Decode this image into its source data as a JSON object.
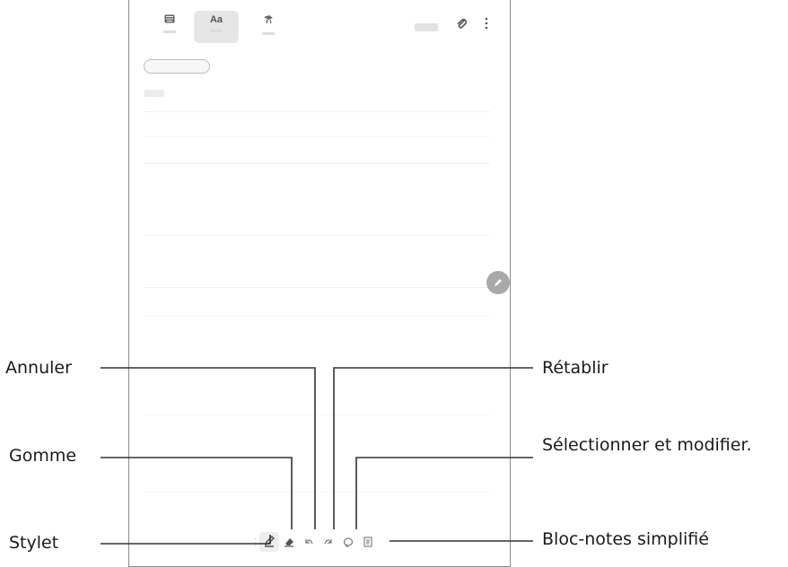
{
  "toolbar": {
    "modes": [
      {
        "icon": "keyboard-icon",
        "glyph": "▭"
      },
      {
        "icon": "text-mode-icon",
        "glyph": "Aa"
      },
      {
        "icon": "brush-icon",
        "glyph": "✎"
      }
    ],
    "attach_icon": "paperclip-icon",
    "more_icon": "more-vertical-icon"
  },
  "fab": {
    "icon": "pen-icon"
  },
  "pen_toolbar": {
    "items": [
      {
        "name": "pen",
        "icon": "pen-icon"
      },
      {
        "name": "eraser",
        "icon": "eraser-icon"
      },
      {
        "name": "undo",
        "icon": "undo-icon"
      },
      {
        "name": "redo",
        "icon": "redo-icon"
      },
      {
        "name": "lasso",
        "icon": "lasso-icon"
      },
      {
        "name": "easy-writing-pad",
        "icon": "writing-pad-icon"
      }
    ]
  },
  "callouts": {
    "annuler": "Annuler",
    "gomme": "Gomme",
    "stylet": "Stylet",
    "retablir": "Rétablir",
    "selectionner": "Sélectionner et modifier.",
    "bloc_notes": "Bloc-notes simplifié"
  },
  "colors": {
    "frame": "#8c8c8c",
    "leader": "#333333",
    "fab": "#a9a9a9"
  }
}
